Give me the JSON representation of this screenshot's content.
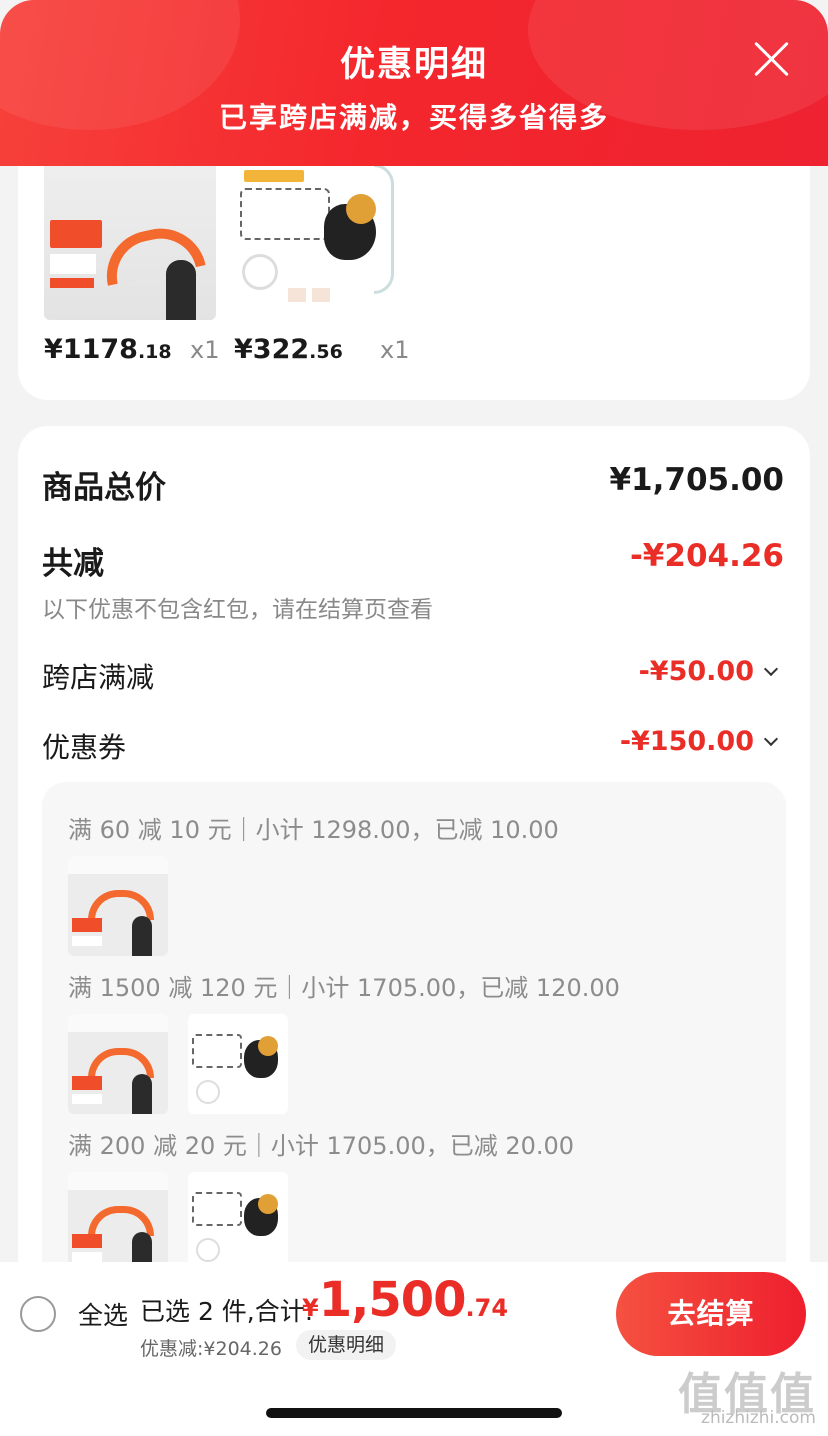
{
  "header": {
    "title": "优惠明细",
    "subtitle": "已享跨店满减，买得多省得多"
  },
  "products": [
    {
      "price_int": "¥1178",
      "price_dec": ".18",
      "qty": "x1"
    },
    {
      "price_int": "¥322",
      "price_dec": ".56",
      "qty": "x1"
    }
  ],
  "summary": {
    "total_label": "商品总价",
    "total_value": "¥1,705.00",
    "reduce_label": "共减",
    "reduce_value": "-¥204.26",
    "note": "以下优惠不包含红包，请在结算页查看",
    "crossstore_label": "跨店满减",
    "crossstore_value": "-¥50.00",
    "coupon_label": "优惠券",
    "coupon_value": "-¥150.00"
  },
  "detail": {
    "lines": [
      "满 60 减 10 元｜小计 1298.00，已减 10.00",
      "满 1500 减 120 元｜小计 1705.00，已减 120.00",
      "满 200 减 20 元｜小计 1705.00，已减 20.00"
    ]
  },
  "bottom": {
    "select_all": "全选",
    "selected_info": "已选 2 件,合计:",
    "total_currency": "¥",
    "total_int": "1,500",
    "total_dec": ".74",
    "discount": "优惠减:¥204.26",
    "detail_link": "优惠明细",
    "checkout": "去结算"
  },
  "watermark": {
    "big": "值值值",
    "small": "zhizhizhi.com"
  },
  "colors": {
    "accent": "#f4272d",
    "price_red": "#ea2d27"
  }
}
